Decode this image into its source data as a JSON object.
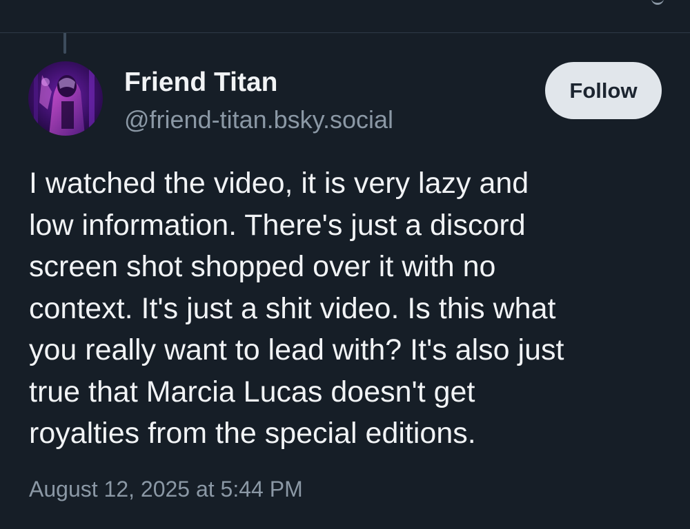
{
  "post": {
    "author": {
      "display_name": "Friend Titan",
      "handle": "@friend-titan.bsky.social"
    },
    "follow_label": "Follow",
    "text_lines": [
      "I watched the video, it is very lazy and",
      "low information. There's just a discord",
      "screen shot shopped over it with no",
      "context. It's just a shit video. Is this what",
      "you really want to lead with? It's also just",
      "true that Marcia Lucas doesn't get",
      "royalties from the special editions."
    ],
    "timestamp": "August 12, 2025 at 5:44 PM"
  },
  "colors": {
    "background": "#161e27",
    "primary_text": "#f1f3f5",
    "secondary_text": "#8b98a5",
    "follow_button_bg": "#e1e6eb",
    "divider": "#2e3a47"
  }
}
